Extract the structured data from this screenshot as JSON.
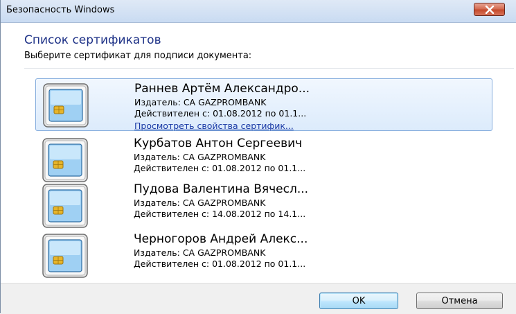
{
  "window": {
    "title": "Безопасность Windows",
    "close_icon": "close-icon"
  },
  "dialog": {
    "heading": "Список сертификатов",
    "subheading": "Выберите сертификат для подписи документа:"
  },
  "certificates": [
    {
      "name": "Раннев Артём Александро...",
      "issuer": "Издатель: CA GAZPROMBANK",
      "valid": "Действителен с: 01.08.2012 по 01.1...",
      "link": "Просмотреть свойства сертифик...",
      "selected": true,
      "icon": "certificate-card-icon"
    },
    {
      "name": "Курбатов Антон Сергеевич",
      "issuer": "Издатель: CA GAZPROMBANK",
      "valid": "Действителен с: 01.08.2012 по 01.1...",
      "selected": false,
      "icon": "certificate-card-icon"
    },
    {
      "name": "Пудова Валентина Вячесл...",
      "issuer": "Издатель: CA GAZPROMBANK",
      "valid": "Действителен с: 14.08.2012 по 14.1...",
      "selected": false,
      "icon": "certificate-card-icon"
    },
    {
      "name": "Черногоров Андрей Алекс...",
      "issuer": "Издатель: CA GAZPROMBANK",
      "valid": "Действителен с: 01.08.2012 по 01.1...",
      "selected": false,
      "icon": "certificate-card-icon"
    }
  ],
  "buttons": {
    "ok": "OK",
    "cancel": "Отмена"
  },
  "colors": {
    "heading": "#1e3287",
    "link": "#1a3aa6",
    "selection_border": "#84acdd",
    "close_button": "#c44a2c"
  }
}
